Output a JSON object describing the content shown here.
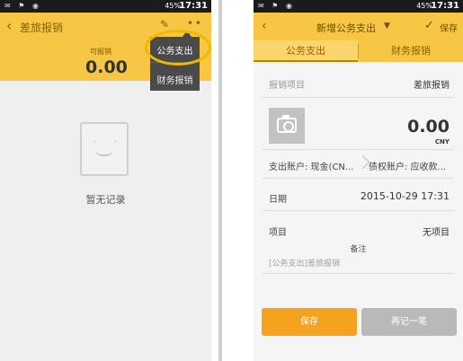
{
  "left": {
    "statusbar": {
      "battery": "45%",
      "time": "17:31"
    },
    "header": {
      "title": "差旅报销"
    },
    "summary": {
      "label": "可报销",
      "amount": "0.00"
    },
    "popup": {
      "items": [
        "公务支出",
        "财务报销"
      ]
    },
    "empty": {
      "text": "暂无记录"
    }
  },
  "right": {
    "statusbar": {
      "battery": "45%",
      "time": "17:31"
    },
    "header": {
      "title": "新增公务支出",
      "save": "保存"
    },
    "tabs": [
      {
        "label": "公务支出",
        "active": true
      },
      {
        "label": "财务报销",
        "active": false
      }
    ],
    "form": {
      "item_label": "报销项目",
      "item_value": "差旅报销",
      "amount": "0.00",
      "currency": "CNY",
      "pay_account": "支出账户: 现金(CN...",
      "credit_account": "债权账户: 应收款...",
      "date_label": "日期",
      "date_value": "2015-10-29 17:31",
      "project_label": "项目",
      "project_value": "无项目",
      "note_label": "备注",
      "note_value": "[公务支出]差旅报销"
    },
    "buttons": {
      "save": "保存",
      "again": "再记一笔"
    }
  },
  "colors": {
    "accent": "#f6c644",
    "primary_button": "#f5a21f",
    "secondary_button": "#b9b9b9",
    "popup": "#4a4a4a"
  }
}
